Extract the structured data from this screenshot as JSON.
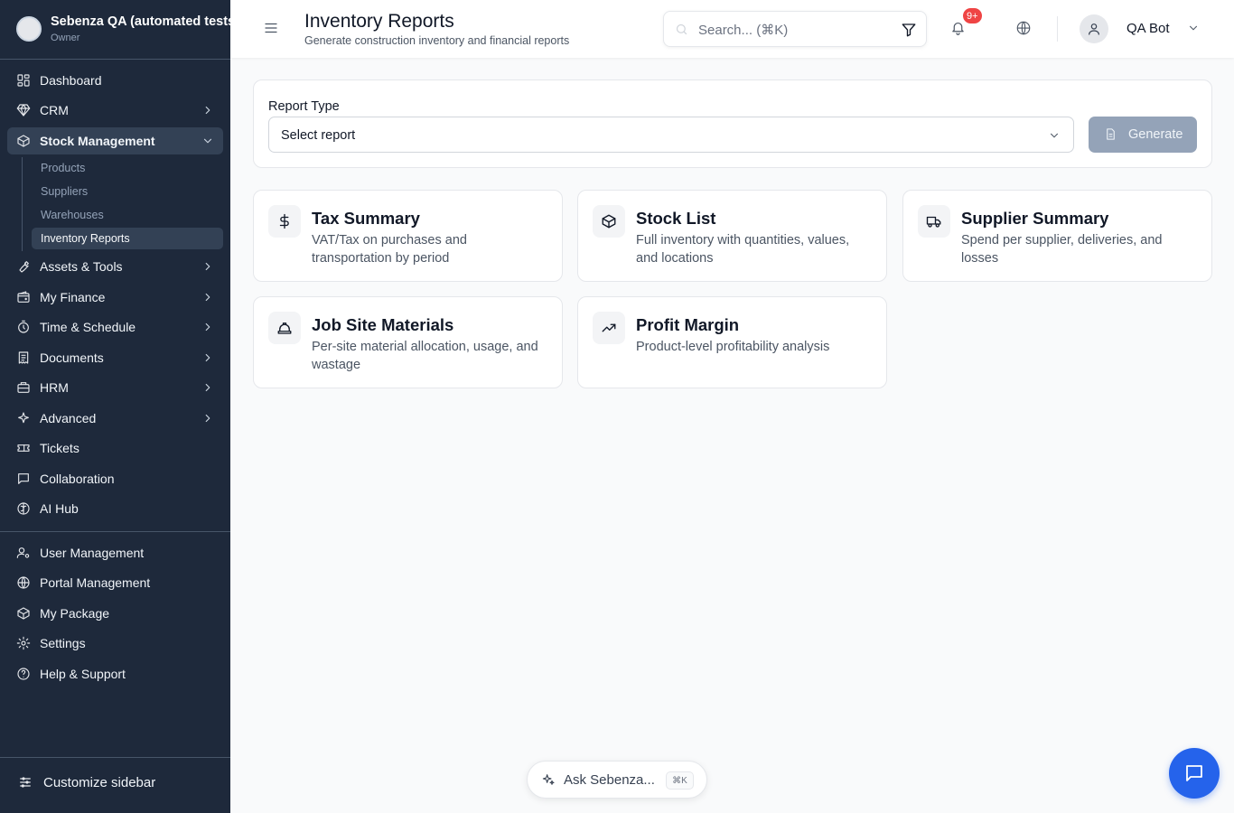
{
  "org": {
    "name": "Sebenza QA (automated tests)",
    "role": "Owner"
  },
  "sidebar": {
    "items": [
      {
        "label": "Dashboard",
        "icon": "dashboard-icon"
      },
      {
        "label": "CRM",
        "icon": "gem-icon",
        "expandable": true
      },
      {
        "label": "Stock Management",
        "icon": "package-icon",
        "expandable": true,
        "expanded": true
      },
      {
        "label": "Assets & Tools",
        "icon": "wrench-icon",
        "expandable": true
      },
      {
        "label": "My Finance",
        "icon": "wallet-icon",
        "expandable": true
      },
      {
        "label": "Time & Schedule",
        "icon": "timer-icon",
        "expandable": true
      },
      {
        "label": "Documents",
        "icon": "receipt-icon",
        "expandable": true
      },
      {
        "label": "HRM",
        "icon": "briefcase-icon",
        "expandable": true
      },
      {
        "label": "Advanced",
        "icon": "sparkles-icon",
        "expandable": true
      },
      {
        "label": "Tickets",
        "icon": "ticket-icon"
      },
      {
        "label": "Collaboration",
        "icon": "message-square-icon"
      },
      {
        "label": "AI Hub",
        "icon": "brain-icon"
      }
    ],
    "stock_sub": [
      {
        "label": "Products"
      },
      {
        "label": "Suppliers"
      },
      {
        "label": "Warehouses"
      },
      {
        "label": "Inventory Reports",
        "active": true
      }
    ],
    "bottom_items": [
      {
        "label": "User Management",
        "icon": "user-cog-icon"
      },
      {
        "label": "Portal Management",
        "icon": "globe-icon"
      },
      {
        "label": "My Package",
        "icon": "package-icon"
      },
      {
        "label": "Settings",
        "icon": "gear-icon"
      },
      {
        "label": "Help & Support",
        "icon": "help-circle-icon"
      }
    ],
    "customize_label": "Customize sidebar"
  },
  "header": {
    "title": "Inventory Reports",
    "subtitle": "Generate construction inventory and financial reports",
    "search_placeholder": "Search... (⌘K)",
    "notification_badge": "9+",
    "user_name": "QA Bot"
  },
  "report_panel": {
    "label": "Report Type",
    "selected": "Select report",
    "generate_label": "Generate"
  },
  "cards": [
    {
      "title": "Tax Summary",
      "desc": "VAT/Tax on purchases and transportation by period",
      "icon": "dollar-icon"
    },
    {
      "title": "Stock List",
      "desc": "Full inventory with quantities, values, and locations",
      "icon": "package-icon"
    },
    {
      "title": "Supplier Summary",
      "desc": "Spend per supplier, deliveries, and losses",
      "icon": "truck-icon"
    },
    {
      "title": "Job Site Materials",
      "desc": "Per-site material allocation, usage, and wastage",
      "icon": "hard-hat-icon"
    },
    {
      "title": "Profit Margin",
      "desc": "Product-level profitability analysis",
      "icon": "trending-up-icon"
    }
  ],
  "ask": {
    "label": "Ask Sebenza...",
    "shortcut": "⌘K"
  },
  "colors": {
    "sidebar_bg": "#1e293b",
    "sidebar_active": "#334155",
    "accent": "#2563eb",
    "badge": "#ef4444",
    "generate_disabled": "#94a3b8"
  }
}
